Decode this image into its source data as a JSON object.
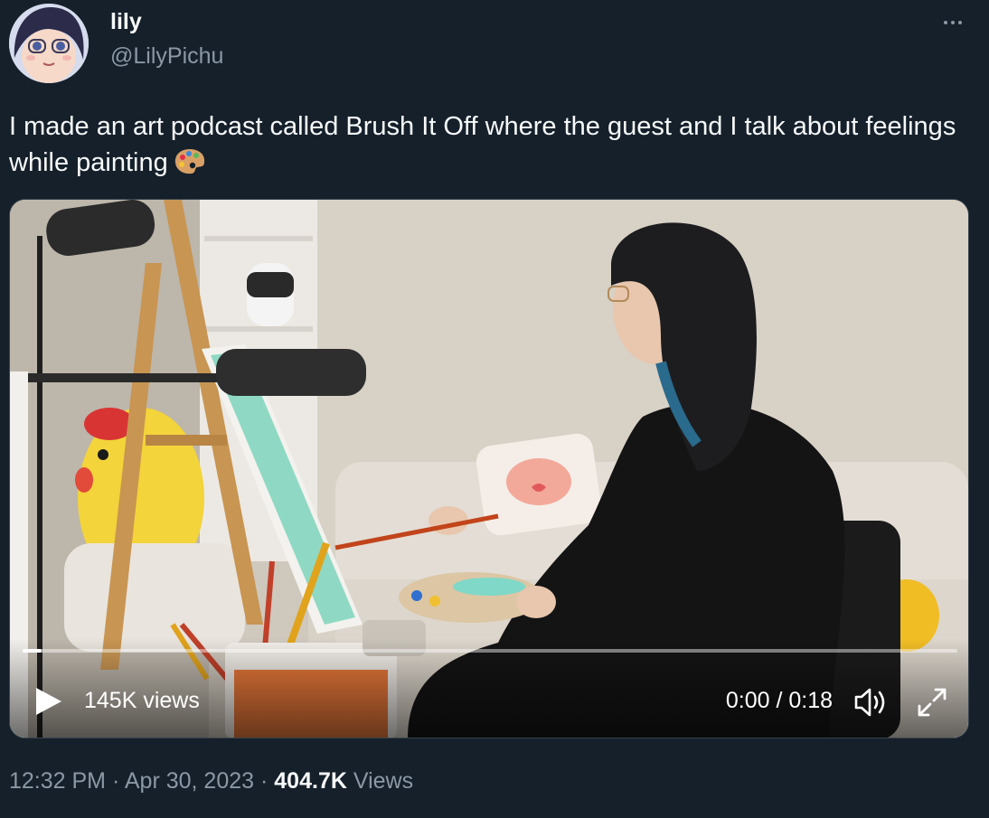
{
  "author": {
    "name": "lily",
    "handle": "@LilyPichu"
  },
  "tweet": {
    "text": "I made an art podcast called Brush It Off where the guest and I talk about feelings while painting",
    "emoji": "artist-palette-icon"
  },
  "video": {
    "views_label": "145K views",
    "time_label": "0:00 / 0:18",
    "progress": 0.02
  },
  "meta": {
    "time": "12:32 PM",
    "separator": "·",
    "date": "Apr 30, 2023",
    "views_count": "404.7K",
    "views_label": "Views"
  },
  "colors": {
    "background": "#15202b",
    "secondary_text": "#8b98a5",
    "primary_text": "#f7f9f9"
  }
}
